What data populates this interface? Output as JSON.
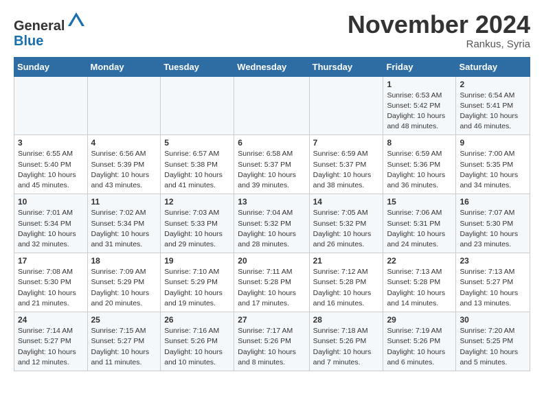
{
  "header": {
    "logo_line1": "General",
    "logo_line2": "Blue",
    "month": "November 2024",
    "location": "Rankus, Syria"
  },
  "weekdays": [
    "Sunday",
    "Monday",
    "Tuesday",
    "Wednesday",
    "Thursday",
    "Friday",
    "Saturday"
  ],
  "weeks": [
    [
      {
        "day": "",
        "info": ""
      },
      {
        "day": "",
        "info": ""
      },
      {
        "day": "",
        "info": ""
      },
      {
        "day": "",
        "info": ""
      },
      {
        "day": "",
        "info": ""
      },
      {
        "day": "1",
        "info": "Sunrise: 6:53 AM\nSunset: 5:42 PM\nDaylight: 10 hours and 48 minutes."
      },
      {
        "day": "2",
        "info": "Sunrise: 6:54 AM\nSunset: 5:41 PM\nDaylight: 10 hours and 46 minutes."
      }
    ],
    [
      {
        "day": "3",
        "info": "Sunrise: 6:55 AM\nSunset: 5:40 PM\nDaylight: 10 hours and 45 minutes."
      },
      {
        "day": "4",
        "info": "Sunrise: 6:56 AM\nSunset: 5:39 PM\nDaylight: 10 hours and 43 minutes."
      },
      {
        "day": "5",
        "info": "Sunrise: 6:57 AM\nSunset: 5:38 PM\nDaylight: 10 hours and 41 minutes."
      },
      {
        "day": "6",
        "info": "Sunrise: 6:58 AM\nSunset: 5:37 PM\nDaylight: 10 hours and 39 minutes."
      },
      {
        "day": "7",
        "info": "Sunrise: 6:59 AM\nSunset: 5:37 PM\nDaylight: 10 hours and 38 minutes."
      },
      {
        "day": "8",
        "info": "Sunrise: 6:59 AM\nSunset: 5:36 PM\nDaylight: 10 hours and 36 minutes."
      },
      {
        "day": "9",
        "info": "Sunrise: 7:00 AM\nSunset: 5:35 PM\nDaylight: 10 hours and 34 minutes."
      }
    ],
    [
      {
        "day": "10",
        "info": "Sunrise: 7:01 AM\nSunset: 5:34 PM\nDaylight: 10 hours and 32 minutes."
      },
      {
        "day": "11",
        "info": "Sunrise: 7:02 AM\nSunset: 5:34 PM\nDaylight: 10 hours and 31 minutes."
      },
      {
        "day": "12",
        "info": "Sunrise: 7:03 AM\nSunset: 5:33 PM\nDaylight: 10 hours and 29 minutes."
      },
      {
        "day": "13",
        "info": "Sunrise: 7:04 AM\nSunset: 5:32 PM\nDaylight: 10 hours and 28 minutes."
      },
      {
        "day": "14",
        "info": "Sunrise: 7:05 AM\nSunset: 5:32 PM\nDaylight: 10 hours and 26 minutes."
      },
      {
        "day": "15",
        "info": "Sunrise: 7:06 AM\nSunset: 5:31 PM\nDaylight: 10 hours and 24 minutes."
      },
      {
        "day": "16",
        "info": "Sunrise: 7:07 AM\nSunset: 5:30 PM\nDaylight: 10 hours and 23 minutes."
      }
    ],
    [
      {
        "day": "17",
        "info": "Sunrise: 7:08 AM\nSunset: 5:30 PM\nDaylight: 10 hours and 21 minutes."
      },
      {
        "day": "18",
        "info": "Sunrise: 7:09 AM\nSunset: 5:29 PM\nDaylight: 10 hours and 20 minutes."
      },
      {
        "day": "19",
        "info": "Sunrise: 7:10 AM\nSunset: 5:29 PM\nDaylight: 10 hours and 19 minutes."
      },
      {
        "day": "20",
        "info": "Sunrise: 7:11 AM\nSunset: 5:28 PM\nDaylight: 10 hours and 17 minutes."
      },
      {
        "day": "21",
        "info": "Sunrise: 7:12 AM\nSunset: 5:28 PM\nDaylight: 10 hours and 16 minutes."
      },
      {
        "day": "22",
        "info": "Sunrise: 7:13 AM\nSunset: 5:28 PM\nDaylight: 10 hours and 14 minutes."
      },
      {
        "day": "23",
        "info": "Sunrise: 7:13 AM\nSunset: 5:27 PM\nDaylight: 10 hours and 13 minutes."
      }
    ],
    [
      {
        "day": "24",
        "info": "Sunrise: 7:14 AM\nSunset: 5:27 PM\nDaylight: 10 hours and 12 minutes."
      },
      {
        "day": "25",
        "info": "Sunrise: 7:15 AM\nSunset: 5:27 PM\nDaylight: 10 hours and 11 minutes."
      },
      {
        "day": "26",
        "info": "Sunrise: 7:16 AM\nSunset: 5:26 PM\nDaylight: 10 hours and 10 minutes."
      },
      {
        "day": "27",
        "info": "Sunrise: 7:17 AM\nSunset: 5:26 PM\nDaylight: 10 hours and 8 minutes."
      },
      {
        "day": "28",
        "info": "Sunrise: 7:18 AM\nSunset: 5:26 PM\nDaylight: 10 hours and 7 minutes."
      },
      {
        "day": "29",
        "info": "Sunrise: 7:19 AM\nSunset: 5:26 PM\nDaylight: 10 hours and 6 minutes."
      },
      {
        "day": "30",
        "info": "Sunrise: 7:20 AM\nSunset: 5:25 PM\nDaylight: 10 hours and 5 minutes."
      }
    ]
  ]
}
